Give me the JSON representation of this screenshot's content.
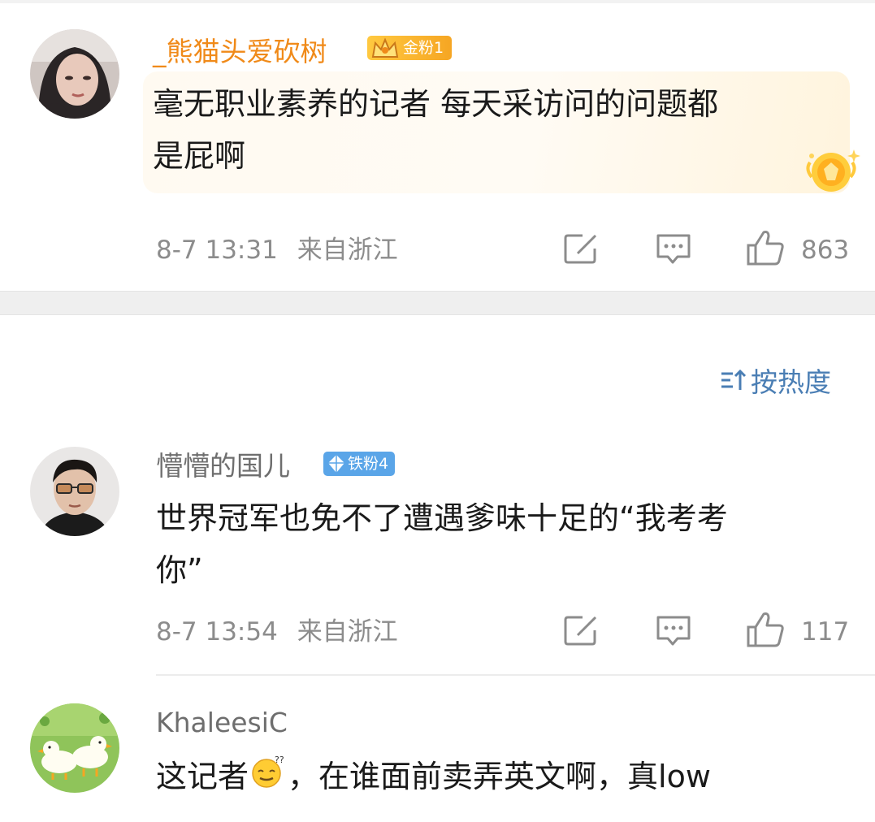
{
  "comments": [
    {
      "username": "_熊猫头爱砍树",
      "badge": "金粉1",
      "text_line1": "毫无职业素养的记者 每天采访问的问题都",
      "text_line2": "是屁啊",
      "time": "8-7 13:31",
      "location": "来自浙江",
      "likes": "863",
      "avatar_icon": "woman-portrait-avatar",
      "highlight": true
    },
    {
      "username": "懵懵的国儿",
      "badge": "铁粉4",
      "text_line1": "世界冠军也免不了遭遇爹味十足的“我考考",
      "text_line2": "你”",
      "time": "8-7 13:54",
      "location": "来自浙江",
      "likes": "117",
      "avatar_icon": "man-sunglasses-avatar"
    },
    {
      "username": "KhaleesiC",
      "text_before_emoji": "这记者",
      "emoji": "thinking-emoji",
      "text_after_emoji": "，在谁面前卖弄英文啊，真low",
      "avatar_icon": "ducks-avatar"
    }
  ],
  "sort": {
    "label": "按热度",
    "icon": "sort-icon"
  },
  "colors": {
    "gold_name": "#f08a19",
    "sort_blue": "#4a7eb4",
    "meta_gray": "#8c8c8c",
    "iron_badge": "#5aa5e8"
  }
}
